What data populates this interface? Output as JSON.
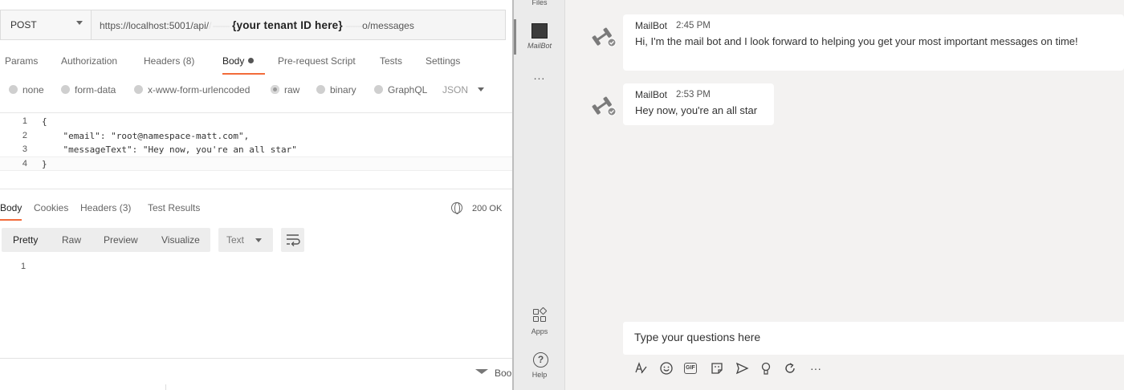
{
  "postman": {
    "method": "POST",
    "url_prefix": "https://localhost:5001/api/",
    "url_redacted_1": "/ -------",
    "url_tenant_placeholder": "{your tenant ID here}",
    "url_redacted_2": "-------",
    "url_suffix": "o/messages",
    "request_tabs": [
      "Params",
      "Authorization",
      "Headers (8)",
      "Body",
      "Pre-request Script",
      "Tests",
      "Settings"
    ],
    "body_types": [
      "none",
      "form-data",
      "x-www-form-urlencoded",
      "raw",
      "binary",
      "GraphQL"
    ],
    "body_type_selected": "raw",
    "format_select": "JSON",
    "editor_lines": [
      {
        "n": "1",
        "code": "{"
      },
      {
        "n": "2",
        "code": "    \"email\": \"root@namespace-matt.com\","
      },
      {
        "n": "3",
        "code": "    \"messageText\": \"Hey now, you're an all star\""
      },
      {
        "n": "4",
        "code": "}"
      }
    ],
    "response_tabs": [
      "Body",
      "Cookies",
      "Headers (3)",
      "Test Results"
    ],
    "status": "200 OK",
    "view_modes": [
      "Pretty",
      "Raw",
      "Preview",
      "Visualize"
    ],
    "view_mode_selected": "Pretty",
    "response_format": "Text",
    "response_lines": [
      "1"
    ],
    "footer_text": "Boo"
  },
  "teams": {
    "rail": {
      "files_label": "Files",
      "mailbot_label": "MailBot",
      "more_label": "...",
      "apps_label": "Apps",
      "help_label": "Help",
      "help_glyph": "?"
    },
    "messages": [
      {
        "sender": "MailBot",
        "time": "2:45 PM",
        "text": "Hi, I'm the mail bot and I look forward to helping you get your most important messages on time!"
      },
      {
        "sender": "MailBot",
        "time": "2:53 PM",
        "text": "Hey now, you're an all star"
      }
    ],
    "compose_placeholder": "Type your questions here",
    "toolbar_icons": [
      "format-icon",
      "emoji-icon",
      "gif-icon",
      "sticker-icon",
      "send-later-icon",
      "praise-icon",
      "loop-icon",
      "more-options-icon"
    ],
    "toolbar_glyphs": {
      "gif": "GIF",
      "more": "···"
    }
  },
  "colors": {
    "tab_accent": "#f26b3a",
    "teams_bg": "#f3f2f1"
  }
}
